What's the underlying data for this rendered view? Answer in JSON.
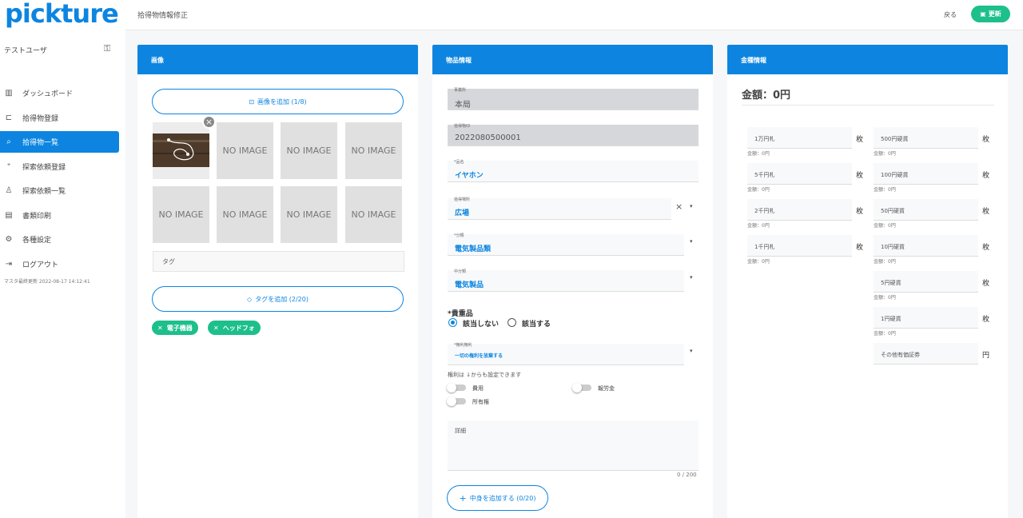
{
  "app": {
    "logo": "pickture"
  },
  "header": {
    "title": "拾得物情報修正",
    "back": "戻る",
    "update": "更新"
  },
  "sidebar": {
    "user": "テストユーザ",
    "items": [
      {
        "label": "ダッシュボード"
      },
      {
        "label": "拾得物登録"
      },
      {
        "label": "拾得物一覧"
      },
      {
        "label": "探索依頼登録"
      },
      {
        "label": "探索依頼一覧"
      },
      {
        "label": "書類印刷"
      },
      {
        "label": "各種設定"
      },
      {
        "label": "ログアウト"
      }
    ],
    "master": "マスタ最終更新 2022-08-17 14:12:41"
  },
  "images": {
    "title": "画像",
    "add": "画像を追加 (1/8)",
    "noimage": "NO IMAGE",
    "tag_placeholder": "タグ",
    "add_tag": "タグを追加 (2/20)",
    "tags": [
      "電子機器",
      "ヘッドフォ"
    ]
  },
  "item": {
    "title": "物品情報",
    "office_label": "事業所",
    "office": "本局",
    "id_label": "拾得物ID",
    "id": "2022080500001",
    "name_label": "*品名",
    "name": "イヤホン",
    "place_label": "拾得場所",
    "place": "広場",
    "cat_label": "*分類",
    "cat": "電気製品類",
    "subcat_label": "中分類",
    "subcat": "電気製品",
    "valuable_label": "*貴重品",
    "valuable_no": "該当しない",
    "valuable_yes": "該当する",
    "rights_label": "*権利権利",
    "rights": "一切の権利を放棄する",
    "rights_hint": "権利は ↓からも設定できます",
    "t_cost": "費用",
    "t_reward": "報労金",
    "t_owner": "所有権",
    "detail": "詳細",
    "counter": "0 / 200",
    "add_content": "中身を追加する (0/20)"
  },
  "money": {
    "title": "金種情報",
    "total": "金額：0円",
    "sub": "金額：0円",
    "left": [
      {
        "name": "1万円札",
        "unit": "枚"
      },
      {
        "name": "5千円札",
        "unit": "枚"
      },
      {
        "name": "2千円札",
        "unit": "枚"
      },
      {
        "name": "1千円札",
        "unit": "枚"
      }
    ],
    "right": [
      {
        "name": "500円硬貨",
        "unit": "枚"
      },
      {
        "name": "100円硬貨",
        "unit": "枚"
      },
      {
        "name": "50円硬貨",
        "unit": "枚"
      },
      {
        "name": "10円硬貨",
        "unit": "枚"
      },
      {
        "name": "5円硬貨",
        "unit": "枚"
      },
      {
        "name": "1円硬貨",
        "unit": "枚"
      },
      {
        "name": "その他有価証券",
        "unit": "円"
      }
    ]
  }
}
